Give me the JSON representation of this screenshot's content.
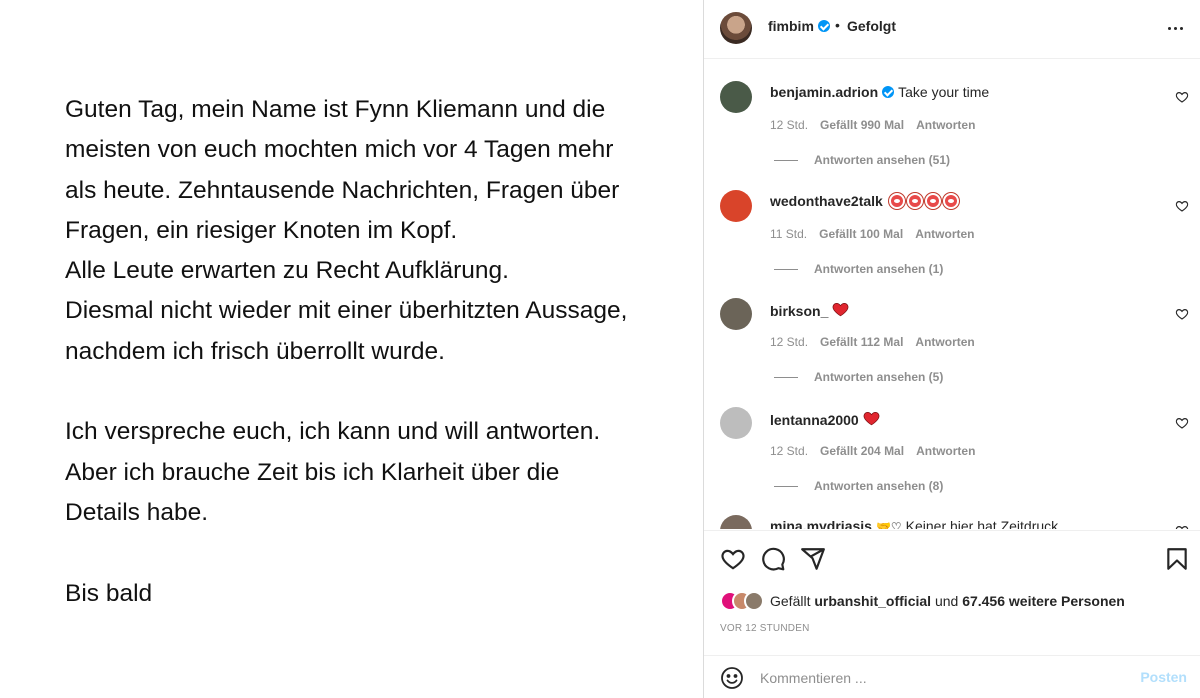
{
  "post": {
    "lines": [
      "Guten Tag, mein Name ist Fynn Kliemann und die",
      "meisten von euch mochten mich vor 4 Tagen mehr",
      "als heute. Zehntausende Nachrichten, Fragen über",
      "Fragen, ein riesiger Knoten im Kopf.",
      "Alle Leute erwarten zu Recht Aufklärung.",
      "Diesmal nicht wieder mit einer überhitzten Aussage,",
      "nachdem ich frisch überrollt wurde.",
      "",
      "Ich verspreche euch, ich kann und will antworten.",
      "Aber ich brauche Zeit bis ich Klarheit über die",
      "Details habe.",
      "",
      "Bis bald"
    ]
  },
  "header": {
    "username": "fimbim",
    "separator": "•",
    "follow_status": "Gefolgt",
    "more_icon": "more-horizontal-icon"
  },
  "comments": [
    {
      "username": "benjamin.adrion",
      "verified": true,
      "text": "Take your time",
      "time": "12 Std.",
      "likes": "Gefällt 990 Mal",
      "reply": "Antworten",
      "view_replies": "Antworten ansehen (51)",
      "avatar_color": "#4a5a48"
    },
    {
      "username": "wedonthave2talk",
      "verified": false,
      "text": "",
      "emoji": "clown-face x4",
      "time": "11 Std.",
      "likes": "Gefällt 100 Mal",
      "reply": "Antworten",
      "view_replies": "Antworten ansehen (1)",
      "avatar_color": "#d9442a"
    },
    {
      "username": "birkson_",
      "verified": false,
      "text": "",
      "emoji": "red-heart",
      "time": "12 Std.",
      "likes": "Gefällt 112 Mal",
      "reply": "Antworten",
      "view_replies": "Antworten ansehen (5)",
      "avatar_color": "#6b6458"
    },
    {
      "username": "lentanna2000",
      "verified": false,
      "text": "",
      "emoji": "red-heart",
      "time": "12 Std.",
      "likes": "Gefällt 204 Mal",
      "reply": "Antworten",
      "view_replies": "Antworten ansehen (8)",
      "avatar_color": "#bdbdbd"
    },
    {
      "username": "mina.mydriasis",
      "verified": false,
      "text": "Keiner hier hat Zeitdruck.",
      "emoji": "handshake-heart",
      "time": "",
      "likes": "",
      "reply": "",
      "view_replies": "",
      "avatar_color": "#7a6a5e"
    }
  ],
  "actions": {
    "like_icon": "heart-outline-icon",
    "comment_icon": "comment-bubble-icon",
    "share_icon": "paper-plane-icon",
    "save_icon": "bookmark-icon"
  },
  "likes": {
    "prefix": "Gefällt",
    "user": "urbanshit_official",
    "middle": "und",
    "count": "67.456 weitere Personen"
  },
  "timestamp": "VOR 12 STUNDEN",
  "composer": {
    "placeholder": "Kommentieren ...",
    "post_label": "Posten"
  },
  "colors": {
    "accent": "#0095f6",
    "post_disabled": "#b2dffc",
    "secondary_text": "#8e8e8e",
    "heart_red": "#ed4956"
  }
}
